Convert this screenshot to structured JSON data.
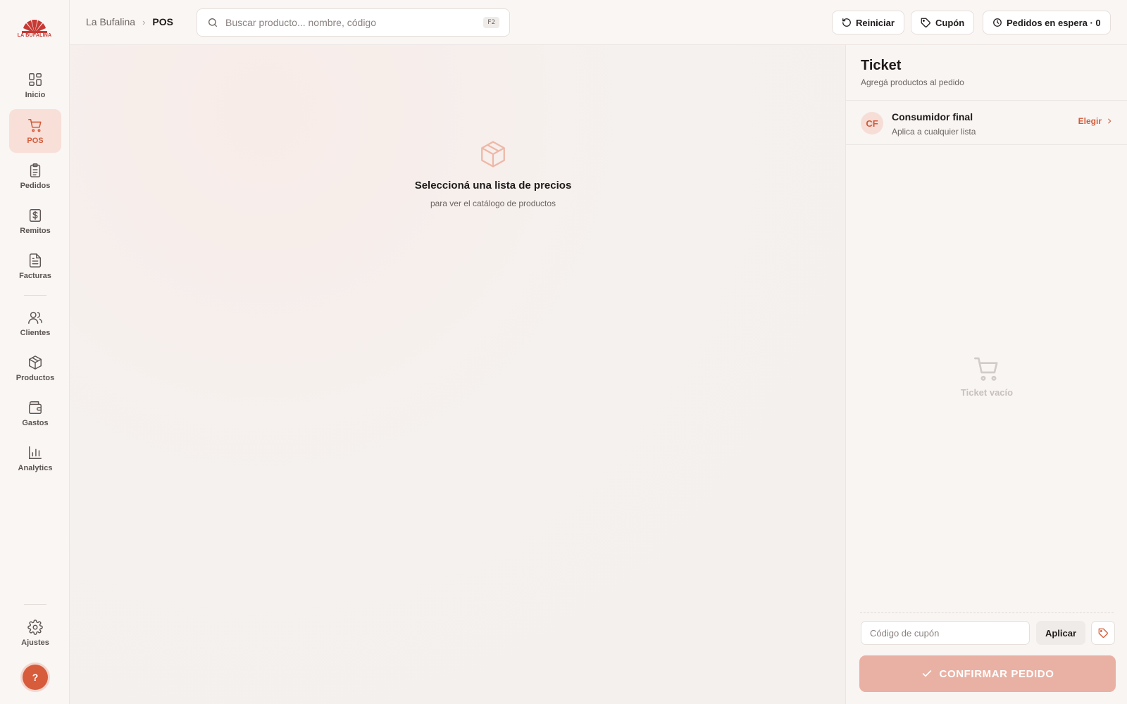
{
  "app": {
    "logo_text": "LA BUFALINA"
  },
  "sidebar": {
    "items": [
      {
        "label": "Inicio",
        "icon": "grid-icon"
      },
      {
        "label": "POS",
        "icon": "cart-icon"
      },
      {
        "label": "Pedidos",
        "icon": "clipboard-icon"
      },
      {
        "label": "Remitos",
        "icon": "dollar-receipt-icon"
      },
      {
        "label": "Facturas",
        "icon": "document-icon"
      },
      {
        "label": "Clientes",
        "icon": "users-icon"
      },
      {
        "label": "Productos",
        "icon": "box-icon"
      },
      {
        "label": "Gastos",
        "icon": "wallet-icon"
      },
      {
        "label": "Analytics",
        "icon": "bar-chart-icon"
      }
    ],
    "settings_label": "Ajustes",
    "help_label": "?",
    "active": "POS"
  },
  "header": {
    "breadcrumb_root": "La Bufalina",
    "breadcrumb_sep": "›",
    "breadcrumb_current": "POS",
    "search_placeholder": "Buscar producto... nombre, código",
    "search_shortcut": "F2",
    "reset_label": "Reiniciar",
    "coupon_label": "Cupón",
    "pending_label": "Pedidos en espera · 0"
  },
  "main": {
    "empty_title": "Seleccioná una lista de precios",
    "empty_subtitle": "para ver el catálogo de productos"
  },
  "ticket": {
    "title": "Ticket",
    "subtitle": "Agregá productos al pedido",
    "customer_initials": "CF",
    "customer_name": "Consumidor final",
    "customer_note": "Aplica a cualquier lista",
    "choose_label": "Elegir",
    "empty_label": "Ticket vacío",
    "coupon_placeholder": "Código de cupón",
    "apply_label": "Aplicar",
    "confirm_label": "CONFIRMAR PEDIDO"
  },
  "colors": {
    "accent": "#d35b3a",
    "active_bg": "#f8dfd8",
    "confirm_disabled": "#e8b1a4"
  }
}
